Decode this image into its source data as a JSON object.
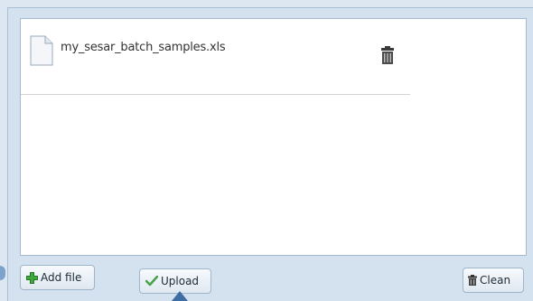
{
  "file_list": {
    "items": [
      {
        "name": "my_sesar_batch_samples.xls",
        "icon": "document-icon",
        "action_icon": "trash-icon"
      }
    ]
  },
  "toolbar": {
    "add_label": "Add file",
    "upload_label": "Upload",
    "clean_label": "Clean"
  },
  "colors": {
    "panel_bg": "#d4e1ee",
    "list_bg": "#ffffff",
    "add_icon": "#3ea93a",
    "upload_icon": "#4aa24a",
    "pointer": "#3d6da3"
  }
}
